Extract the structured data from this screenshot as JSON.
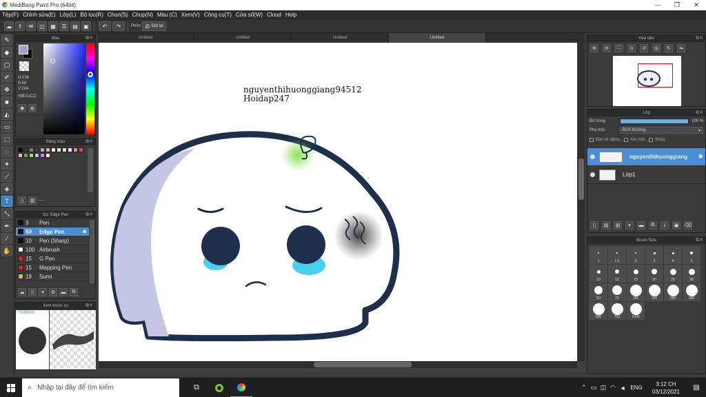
{
  "window": {
    "title": "MediBang Paint Pro (64bit)",
    "min": "—",
    "max": "❐",
    "close": "✕"
  },
  "menu": [
    "Tệp(F)",
    "Chỉnh sửa(E)",
    "Lớp(L)",
    "Bộ lọc(R)",
    "Chọn(S)",
    "Chụp(N)",
    "Màu (C)",
    "Xem(V)",
    "Công cụ(T)",
    "Cửa sổ(W)",
    "Cloud",
    "Help"
  ],
  "toolbar": {
    "key_label": "Phím",
    "reset_label": "Đặt lại"
  },
  "color_panel": {
    "title": "Màu",
    "h": "H:236",
    "s": "S:58",
    "v": "V:204",
    "hex": "#9EA1CC",
    "main_color": "#9EA1CC"
  },
  "swatch_panel": {
    "title": "Bảng màu",
    "name": "----",
    "colors": [
      "#000000",
      "#3a3a3a",
      "#7a7a7a",
      "#5a3c2a",
      "#b0b0b0",
      "#d2b48c",
      "#eeeeee",
      "#f5e6c8",
      "#ffd8b0",
      "#f2f2f2",
      "#ff8080",
      "#ff4040",
      "#ffb080",
      "#6aa84f",
      "#99e550",
      "#a0c8ff",
      "#ff60ff",
      "#ffffff"
    ]
  },
  "brush_panel": {
    "title": "Cọ: Edge Pen",
    "items": [
      {
        "size": "3",
        "name": "Pen",
        "color": "#111111"
      },
      {
        "size": "50",
        "name": "Edge Pen",
        "color": "#111111"
      },
      {
        "size": "10",
        "name": "Pen (Sharp)",
        "color": "#111111"
      },
      {
        "size": "100",
        "name": "Airbrush",
        "color": "#ffffff"
      },
      {
        "size": "15",
        "name": "G Pen",
        "color": "#e02020"
      },
      {
        "size": "15",
        "name": "Mapping Pen",
        "color": "#e02020"
      },
      {
        "size": "19",
        "name": "Sumi",
        "color": "#e0c020"
      }
    ]
  },
  "preview_panel": {
    "title": "Xem trước cọ",
    "size": "* 3.63mm"
  },
  "doc_tabs": [
    "Untitled",
    "Untitled",
    "Untitled",
    "Untitled"
  ],
  "canvas": {
    "line1": "nguyenthihuonggiang94512",
    "line2": "Hoidap247"
  },
  "navigator": {
    "title": "Hoa tiêu"
  },
  "layers": {
    "title": "Lớp",
    "opacity_label": "Độ trong",
    "opacity_value": "100 %",
    "opacity_fraction": 1.0,
    "blend_label": "Pha trộn",
    "blend_value": "Bình thường",
    "protect_alpha": "Bảo vệ alpha",
    "clipping": "Xén bớt",
    "lock": "Khóa",
    "items": [
      {
        "name": "nguyenthihuonggiang",
        "selected": true
      },
      {
        "name": "Lớp1",
        "selected": false
      }
    ]
  },
  "brush_size": {
    "title": "Brush Size",
    "sizes": [
      "1",
      "1.5",
      "2",
      "3",
      "4",
      "5",
      "10",
      "12",
      "15",
      "20",
      "25",
      "30",
      "50",
      "70",
      "100",
      "150",
      "200",
      "300",
      "500",
      "700",
      "1000"
    ]
  },
  "taskbar": {
    "search_placeholder": "Nhập tại đây để tìm kiếm",
    "lang": "ENG",
    "time": "3:12 CH",
    "date": "03/12/2021"
  }
}
